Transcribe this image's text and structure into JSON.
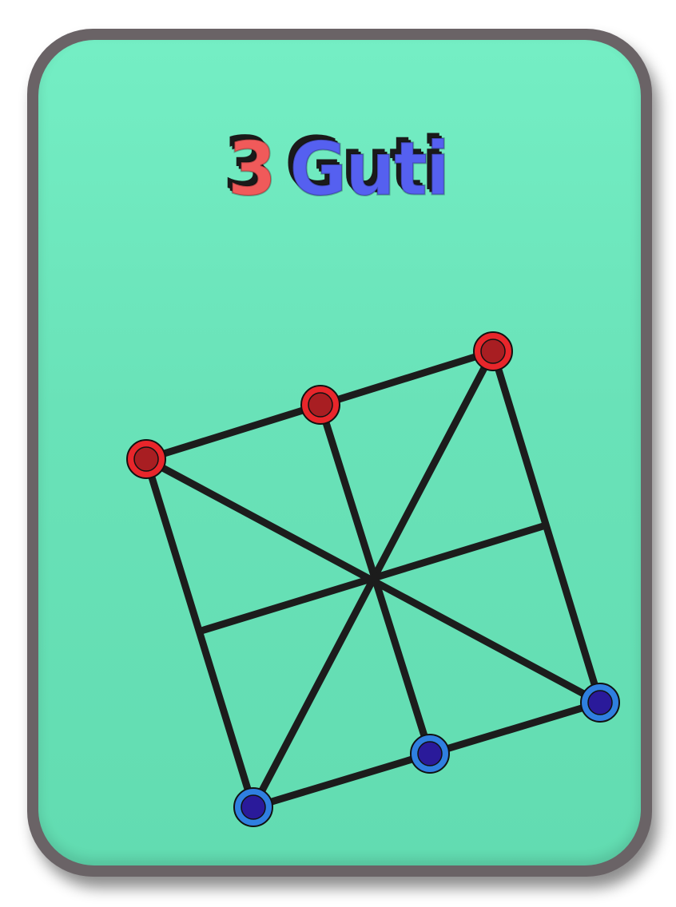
{
  "title": {
    "number": "3",
    "word": "Guti",
    "number_color": "#f05a5a",
    "word_color": "#5560f0"
  },
  "card": {
    "border_color": "#6a6366",
    "face_color": "#6ee6bc"
  },
  "board": {
    "line_color": "#1c1c1c"
  },
  "pieces": {
    "red": {
      "fill": "#a81e22",
      "ring": "#e8262b",
      "count": 3
    },
    "blue": {
      "fill": "#2a1a9a",
      "ring": "#2f7fe0",
      "count": 3
    }
  }
}
